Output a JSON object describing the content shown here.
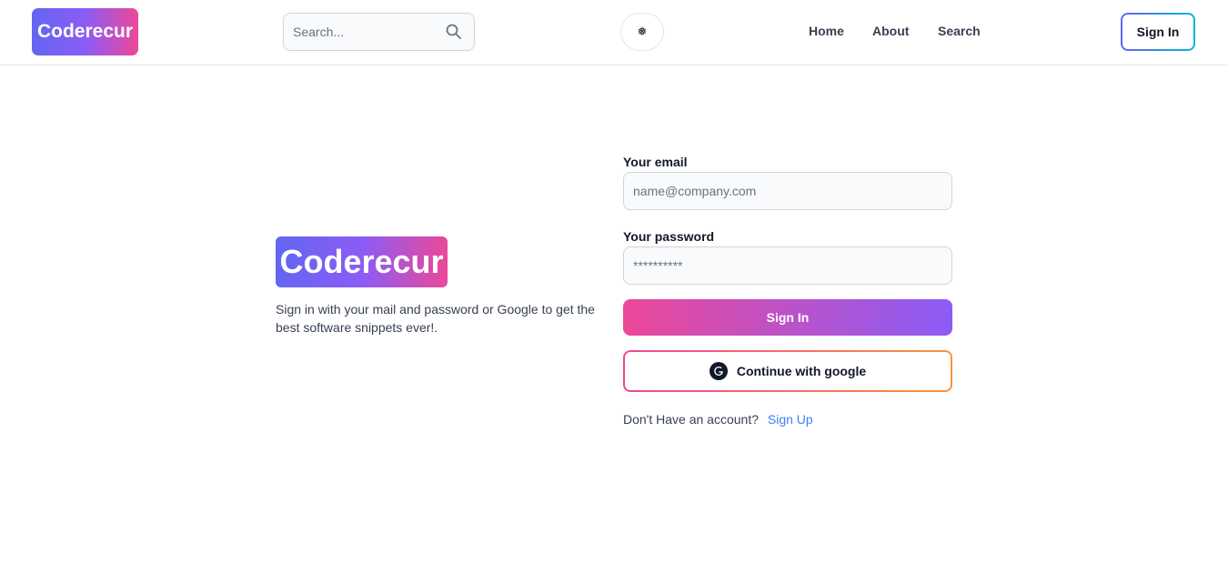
{
  "header": {
    "logo": "Coderecur",
    "search_placeholder": "Search...",
    "theme_toggle_symbol": "❅",
    "nav": [
      "Home",
      "About",
      "Search"
    ],
    "signin_label": "Sign In",
    "icons": {
      "search": "search-icon",
      "theme": "snowflake-icon"
    }
  },
  "hero": {
    "logo": "Coderecur",
    "tagline": "Sign in with your mail and password or Google to get the best software snippets ever!."
  },
  "form": {
    "email_label": "Your email",
    "email_placeholder": "name@company.com",
    "password_label": "Your password",
    "password_placeholder": "**********",
    "signin_button": "Sign In",
    "google_button": "Continue with google",
    "google_icon": "google-icon",
    "no_account_text": "Don't Have an account?",
    "signup_link": "Sign Up"
  },
  "colors": {
    "brand_gradient_start": "#6366f1",
    "brand_gradient_end": "#ec4899",
    "link": "#3b82f6"
  }
}
